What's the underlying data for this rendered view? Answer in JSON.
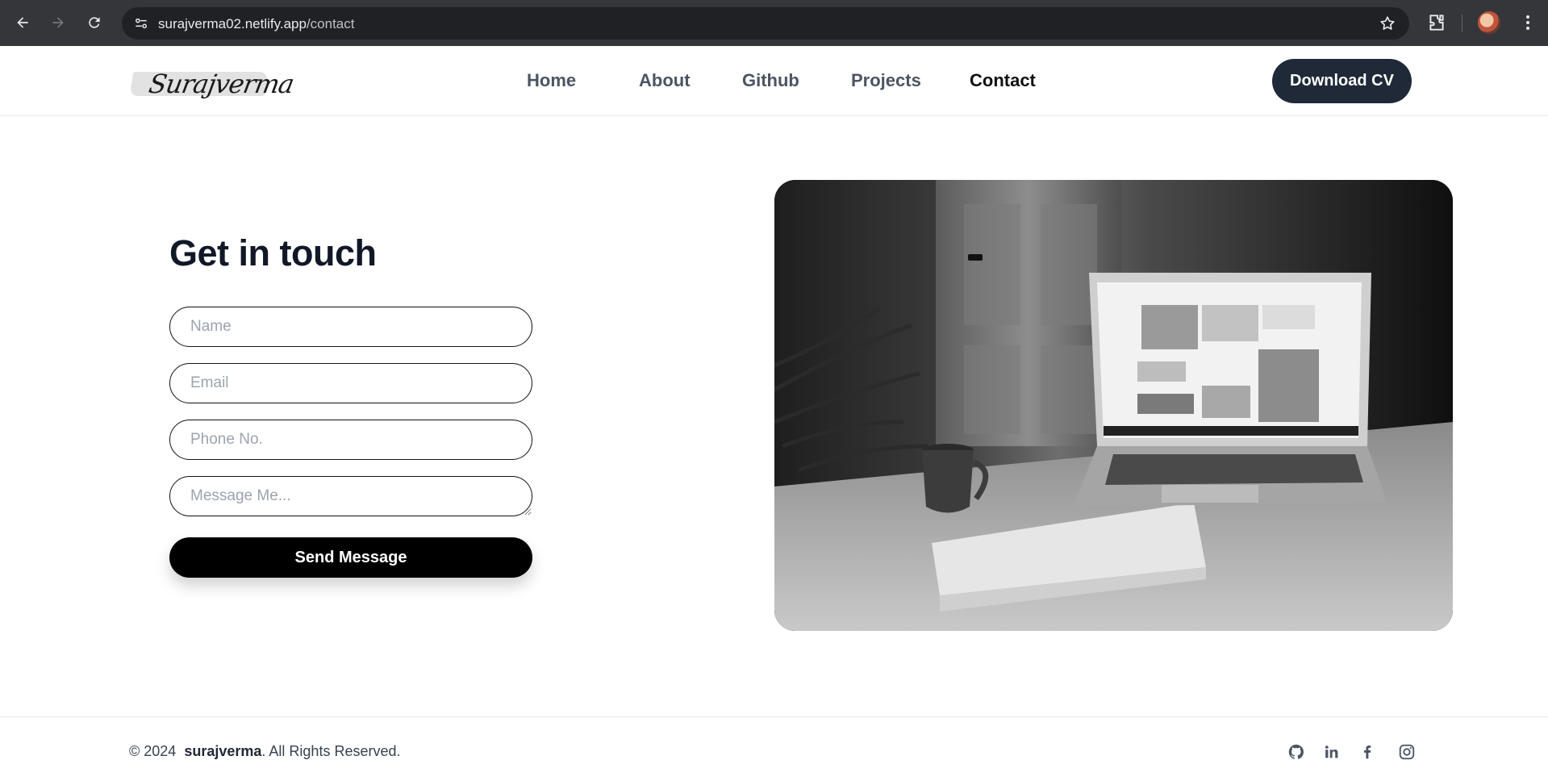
{
  "browser": {
    "url_host": "surajverma02.netlify.app",
    "url_path": "/contact"
  },
  "header": {
    "logo_text": "Surajverma",
    "nav": [
      {
        "label": "Home"
      },
      {
        "label": "About"
      },
      {
        "label": "Github"
      },
      {
        "label": "Projects"
      },
      {
        "label": "Contact",
        "active": true
      }
    ],
    "cv_button": "Download CV"
  },
  "contact": {
    "title": "Get in touch",
    "fields": {
      "name_placeholder": "Name",
      "email_placeholder": "Email",
      "phone_placeholder": "Phone No.",
      "message_placeholder": "Message Me..."
    },
    "send_button": "Send Message"
  },
  "footer": {
    "copyright_prefix": "© 2024",
    "brand": "surajverma",
    "copyright_suffix": ". All Rights Reserved.",
    "social_icons": [
      "github-icon",
      "linkedin-icon",
      "facebook-icon",
      "instagram-icon"
    ]
  },
  "colors": {
    "chrome_bg": "#35363a",
    "cv_button_bg": "#1f2937",
    "send_button_bg": "#000000",
    "active_nav": "#111111",
    "nav_text": "#4b5563"
  }
}
